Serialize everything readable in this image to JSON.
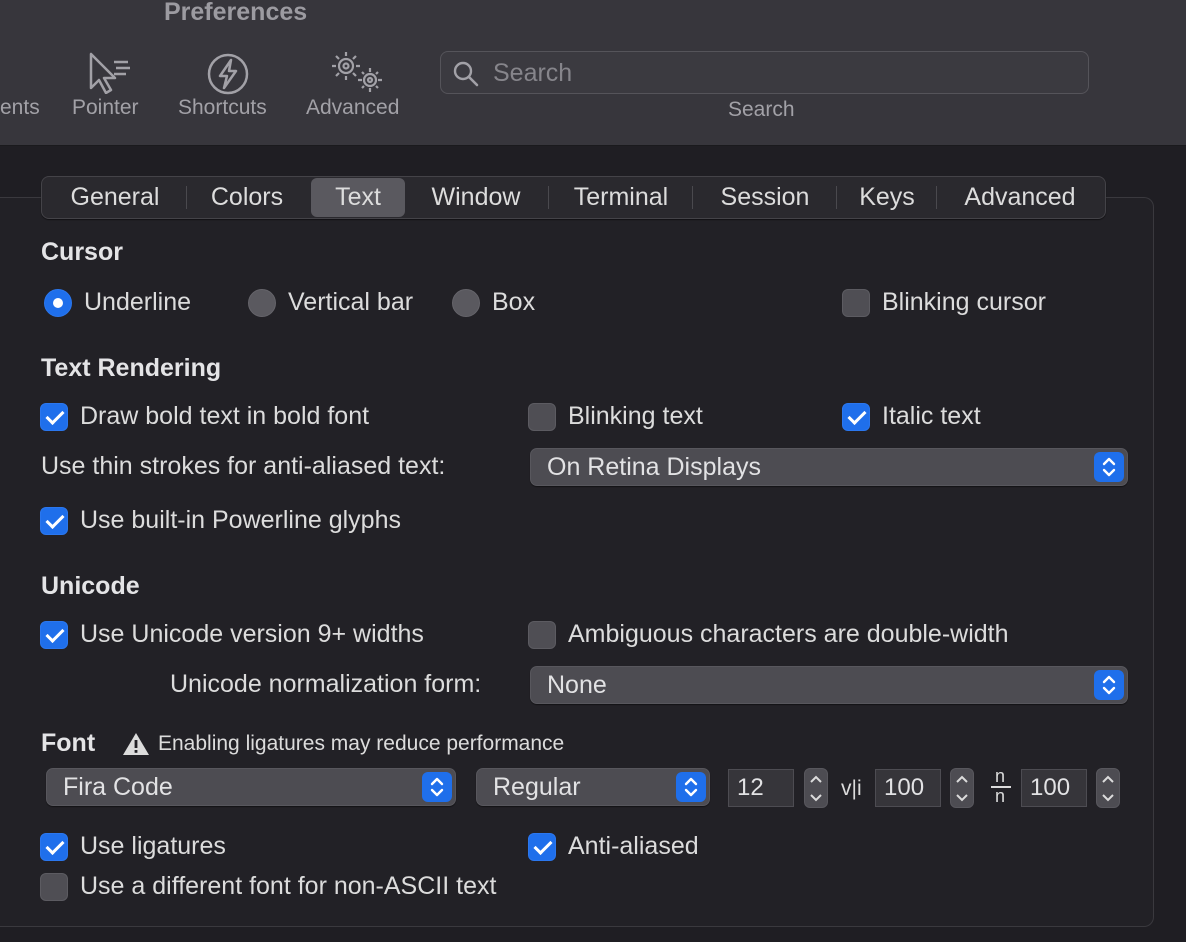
{
  "window": {
    "title": "Preferences"
  },
  "toolbar": {
    "items": [
      {
        "label": "ents",
        "icon": "profiles-icon"
      },
      {
        "label": "Pointer",
        "icon": "pointer-icon"
      },
      {
        "label": "Shortcuts",
        "icon": "lightning-icon"
      },
      {
        "label": "Advanced",
        "icon": "gears-icon"
      }
    ],
    "search": {
      "placeholder": "Search",
      "caption": "Search"
    }
  },
  "tabs": [
    "General",
    "Colors",
    "Text",
    "Window",
    "Terminal",
    "Session",
    "Keys",
    "Advanced"
  ],
  "active_tab": "Text",
  "cursor": {
    "title": "Cursor",
    "options": [
      {
        "label": "Underline",
        "selected": true
      },
      {
        "label": "Vertical bar",
        "selected": false
      },
      {
        "label": "Box",
        "selected": false
      }
    ],
    "blinking": {
      "label": "Blinking cursor",
      "checked": false
    }
  },
  "text_rendering": {
    "title": "Text Rendering",
    "bold": {
      "label": "Draw bold text in bold font",
      "checked": true
    },
    "blinking_text": {
      "label": "Blinking text",
      "checked": false
    },
    "italic": {
      "label": "Italic text",
      "checked": true
    },
    "thin_strokes": {
      "label": "Use thin strokes for anti-aliased text:",
      "value": "On Retina Displays"
    },
    "powerline": {
      "label": "Use built-in Powerline glyphs",
      "checked": true
    }
  },
  "unicode": {
    "title": "Unicode",
    "widths": {
      "label": "Use Unicode version 9+ widths",
      "checked": true
    },
    "ambiguous": {
      "label": "Ambiguous characters are double-width",
      "checked": false
    },
    "normalization": {
      "label": "Unicode normalization form:",
      "value": "None"
    }
  },
  "font": {
    "title": "Font",
    "warning": "Enabling ligatures may reduce performance",
    "family": "Fira Code",
    "style": "Regular",
    "size": "12",
    "h_spacing_glyph": "v|i",
    "h_spacing": "100",
    "v_spacing_glyph_top": "n",
    "v_spacing_glyph_bottom": "n",
    "v_spacing": "100",
    "ligatures": {
      "label": "Use ligatures",
      "checked": true
    },
    "anti_aliased": {
      "label": "Anti-aliased",
      "checked": true
    },
    "non_ascii": {
      "label": "Use a different font for non-ASCII text",
      "checked": false
    }
  },
  "colors": {
    "accent": "#1f6feb",
    "background": "#1f1e23",
    "toolbar": "#37363c"
  }
}
